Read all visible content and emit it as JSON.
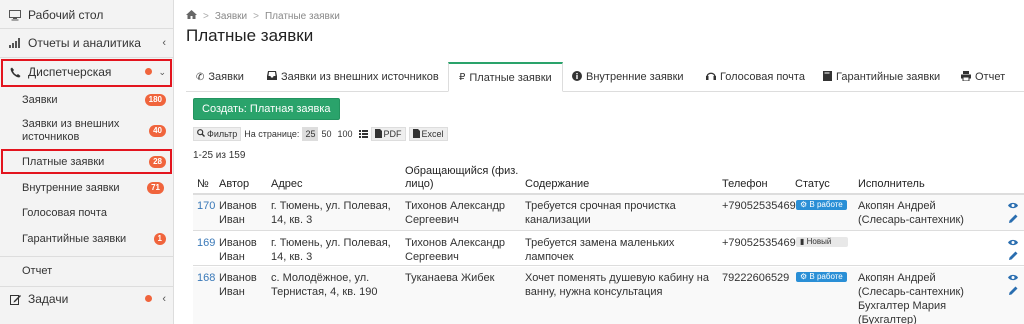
{
  "sidebar": {
    "desktop": "Рабочий стол",
    "reports": "Отчеты и аналитика",
    "dispatch": "Диспетчерская",
    "sub": [
      {
        "label": "Заявки",
        "badge": "180"
      },
      {
        "label": "Заявки из внешних источников",
        "badge": "40"
      },
      {
        "label": "Платные заявки",
        "badge": "28"
      },
      {
        "label": "Внутренние заявки",
        "badge": "71"
      },
      {
        "label": "Голосовая почта",
        "badge": ""
      },
      {
        "label": "Гарантийные заявки",
        "badge": "1"
      }
    ],
    "report": "Отчет",
    "tasks": "Задачи"
  },
  "breadcrumb": {
    "home_icon": "home-icon",
    "item1": "Заявки",
    "item2": "Платные заявки"
  },
  "page_title": "Платные заявки",
  "tabs": [
    {
      "label": "Заявки",
      "icon": "phone-icon"
    },
    {
      "label": "Заявки из внешних источников",
      "icon": "inbox-icon"
    },
    {
      "label": "Платные заявки",
      "icon": "ruble-icon"
    },
    {
      "label": "Внутренние заявки",
      "icon": "info-icon"
    },
    {
      "label": "Голосовая почта",
      "icon": "headphones-icon"
    },
    {
      "label": "Гарантийные заявки",
      "icon": "book-icon"
    },
    {
      "label": "Отчет",
      "icon": "print-icon"
    }
  ],
  "create_button": "Создать: Платная заявка",
  "toolbar": {
    "filter": "Фильтр",
    "per_page_label": "На странице:",
    "per_page": [
      "25",
      "50",
      "100"
    ],
    "pdf": "PDF",
    "excel": "Excel"
  },
  "count_text": "1-25 из 159",
  "table": {
    "headers": [
      "№",
      "Автор",
      "Адрес",
      "Обращающийся (физ. лицо)",
      "Содержание",
      "Телефон",
      "Статус",
      "Исполнитель"
    ],
    "rows": [
      {
        "num": "170",
        "author": "Иванов Иван",
        "address": "г. Тюмень, ул. Полевая, 14, кв. 3",
        "person": "Тихонов Александр Сергеевич",
        "content": "Требуется срочная прочистка канализации",
        "phone": "+79052535469",
        "status": "В работе",
        "executor": "Акопян Андрей (Слесарь-сантехник)"
      },
      {
        "num": "169",
        "author": "Иванов Иван",
        "address": "г. Тюмень, ул. Полевая, 14, кв. 3",
        "person": "Тихонов Александр Сергеевич",
        "content": "Требуется замена маленьких лампочек",
        "phone": "+79052535469",
        "status": "Новый",
        "executor": ""
      },
      {
        "num": "168",
        "author": "Иванов Иван",
        "address": "с. Молодёжное, ул. Тернистая, 4, кв. 190",
        "person": "Туканаева Жибек",
        "content": "Хочет поменять душевую кабину на ванну, нужна консультация",
        "phone": "79222606529",
        "status": "В работе",
        "executor": "Акопян Андрей (Слесарь-сантехник) Бухгалтер Мария (Бухгалтер)"
      }
    ]
  },
  "colors": {
    "accent": "#2aa36b",
    "badge": "#f0643c",
    "highlight": "#e3141e",
    "link": "#3a79b8",
    "status_work": "#2a8fd6"
  }
}
